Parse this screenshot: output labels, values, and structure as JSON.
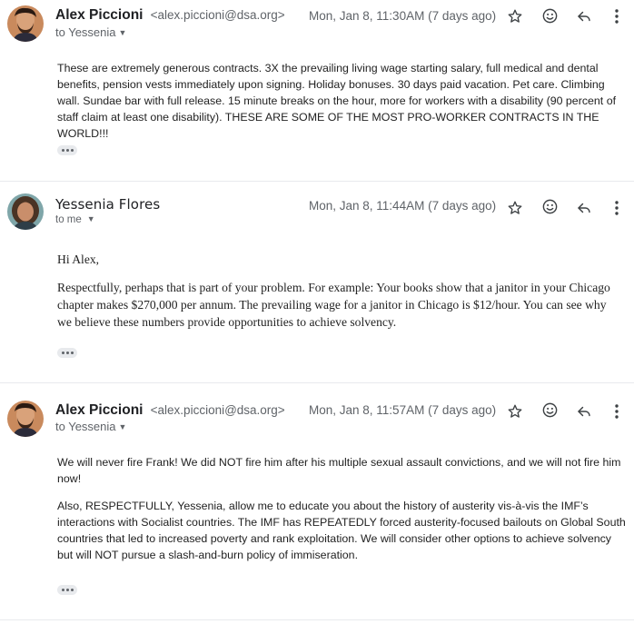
{
  "messages": [
    {
      "sender_name": "Alex Piccioni",
      "sender_email": "<alex.piccioni@dsa.org>",
      "to_label": "to Yessenia",
      "date": "Mon, Jan 8, 11:30AM (7 days ago)",
      "paragraphs": [
        "These are extremely generous contracts. 3X the prevailing living wage starting salary, full medical and dental benefits, pension vests immediately upon signing. Holiday bonuses. 30 days paid vacation. Pet care. Climbing wall. Sundae bar with full release. 15 minute breaks on the hour, more for workers with a disability (90 percent of staff claim at least one disability). THESE ARE SOME OF THE MOST PRO-WORKER CONTRACTS IN THE WORLD!!!"
      ]
    },
    {
      "sender_name": "Yessenia Flores",
      "sender_email": "",
      "to_label": "to me",
      "date": "Mon, Jan 8, 11:44AM (7 days ago)",
      "paragraphs": [
        "Hi Alex,",
        "Respectfully, perhaps that is part of your problem. For example: Your books show that a janitor in your Chicago chapter makes $270,000 per annum. The prevailing wage for a janitor in Chicago is $12/hour. You can see why we believe these numbers provide opportunities to achieve solvency."
      ]
    },
    {
      "sender_name": "Alex Piccioni",
      "sender_email": "<alex.piccioni@dsa.org>",
      "to_label": "to Yessenia",
      "date": "Mon, Jan 8, 11:57AM (7 days ago)",
      "paragraphs": [
        "We will never fire Frank! We did NOT fire him after his multiple sexual assault convictions, and we will not fire him now!",
        "Also, RESPECTFULLY, Yessenia, allow me to educate you about the history of austerity vis-à-vis the IMF’s interactions with Socialist countries. The IMF has REPEATEDLY forced austerity-focused bailouts on Global South countries that led to increased poverty and rank exploitation. We will consider other options to achieve solvency but will NOT pursue a slash-and-burn policy of immiseration."
      ]
    }
  ],
  "icons": [
    "star-icon",
    "emoji-icon",
    "reply-icon",
    "more-vert-icon",
    "show-trimmed-content-icon"
  ],
  "colors": {
    "text": "#202124",
    "secondary": "#5f6368",
    "divider": "#e8eaed"
  }
}
